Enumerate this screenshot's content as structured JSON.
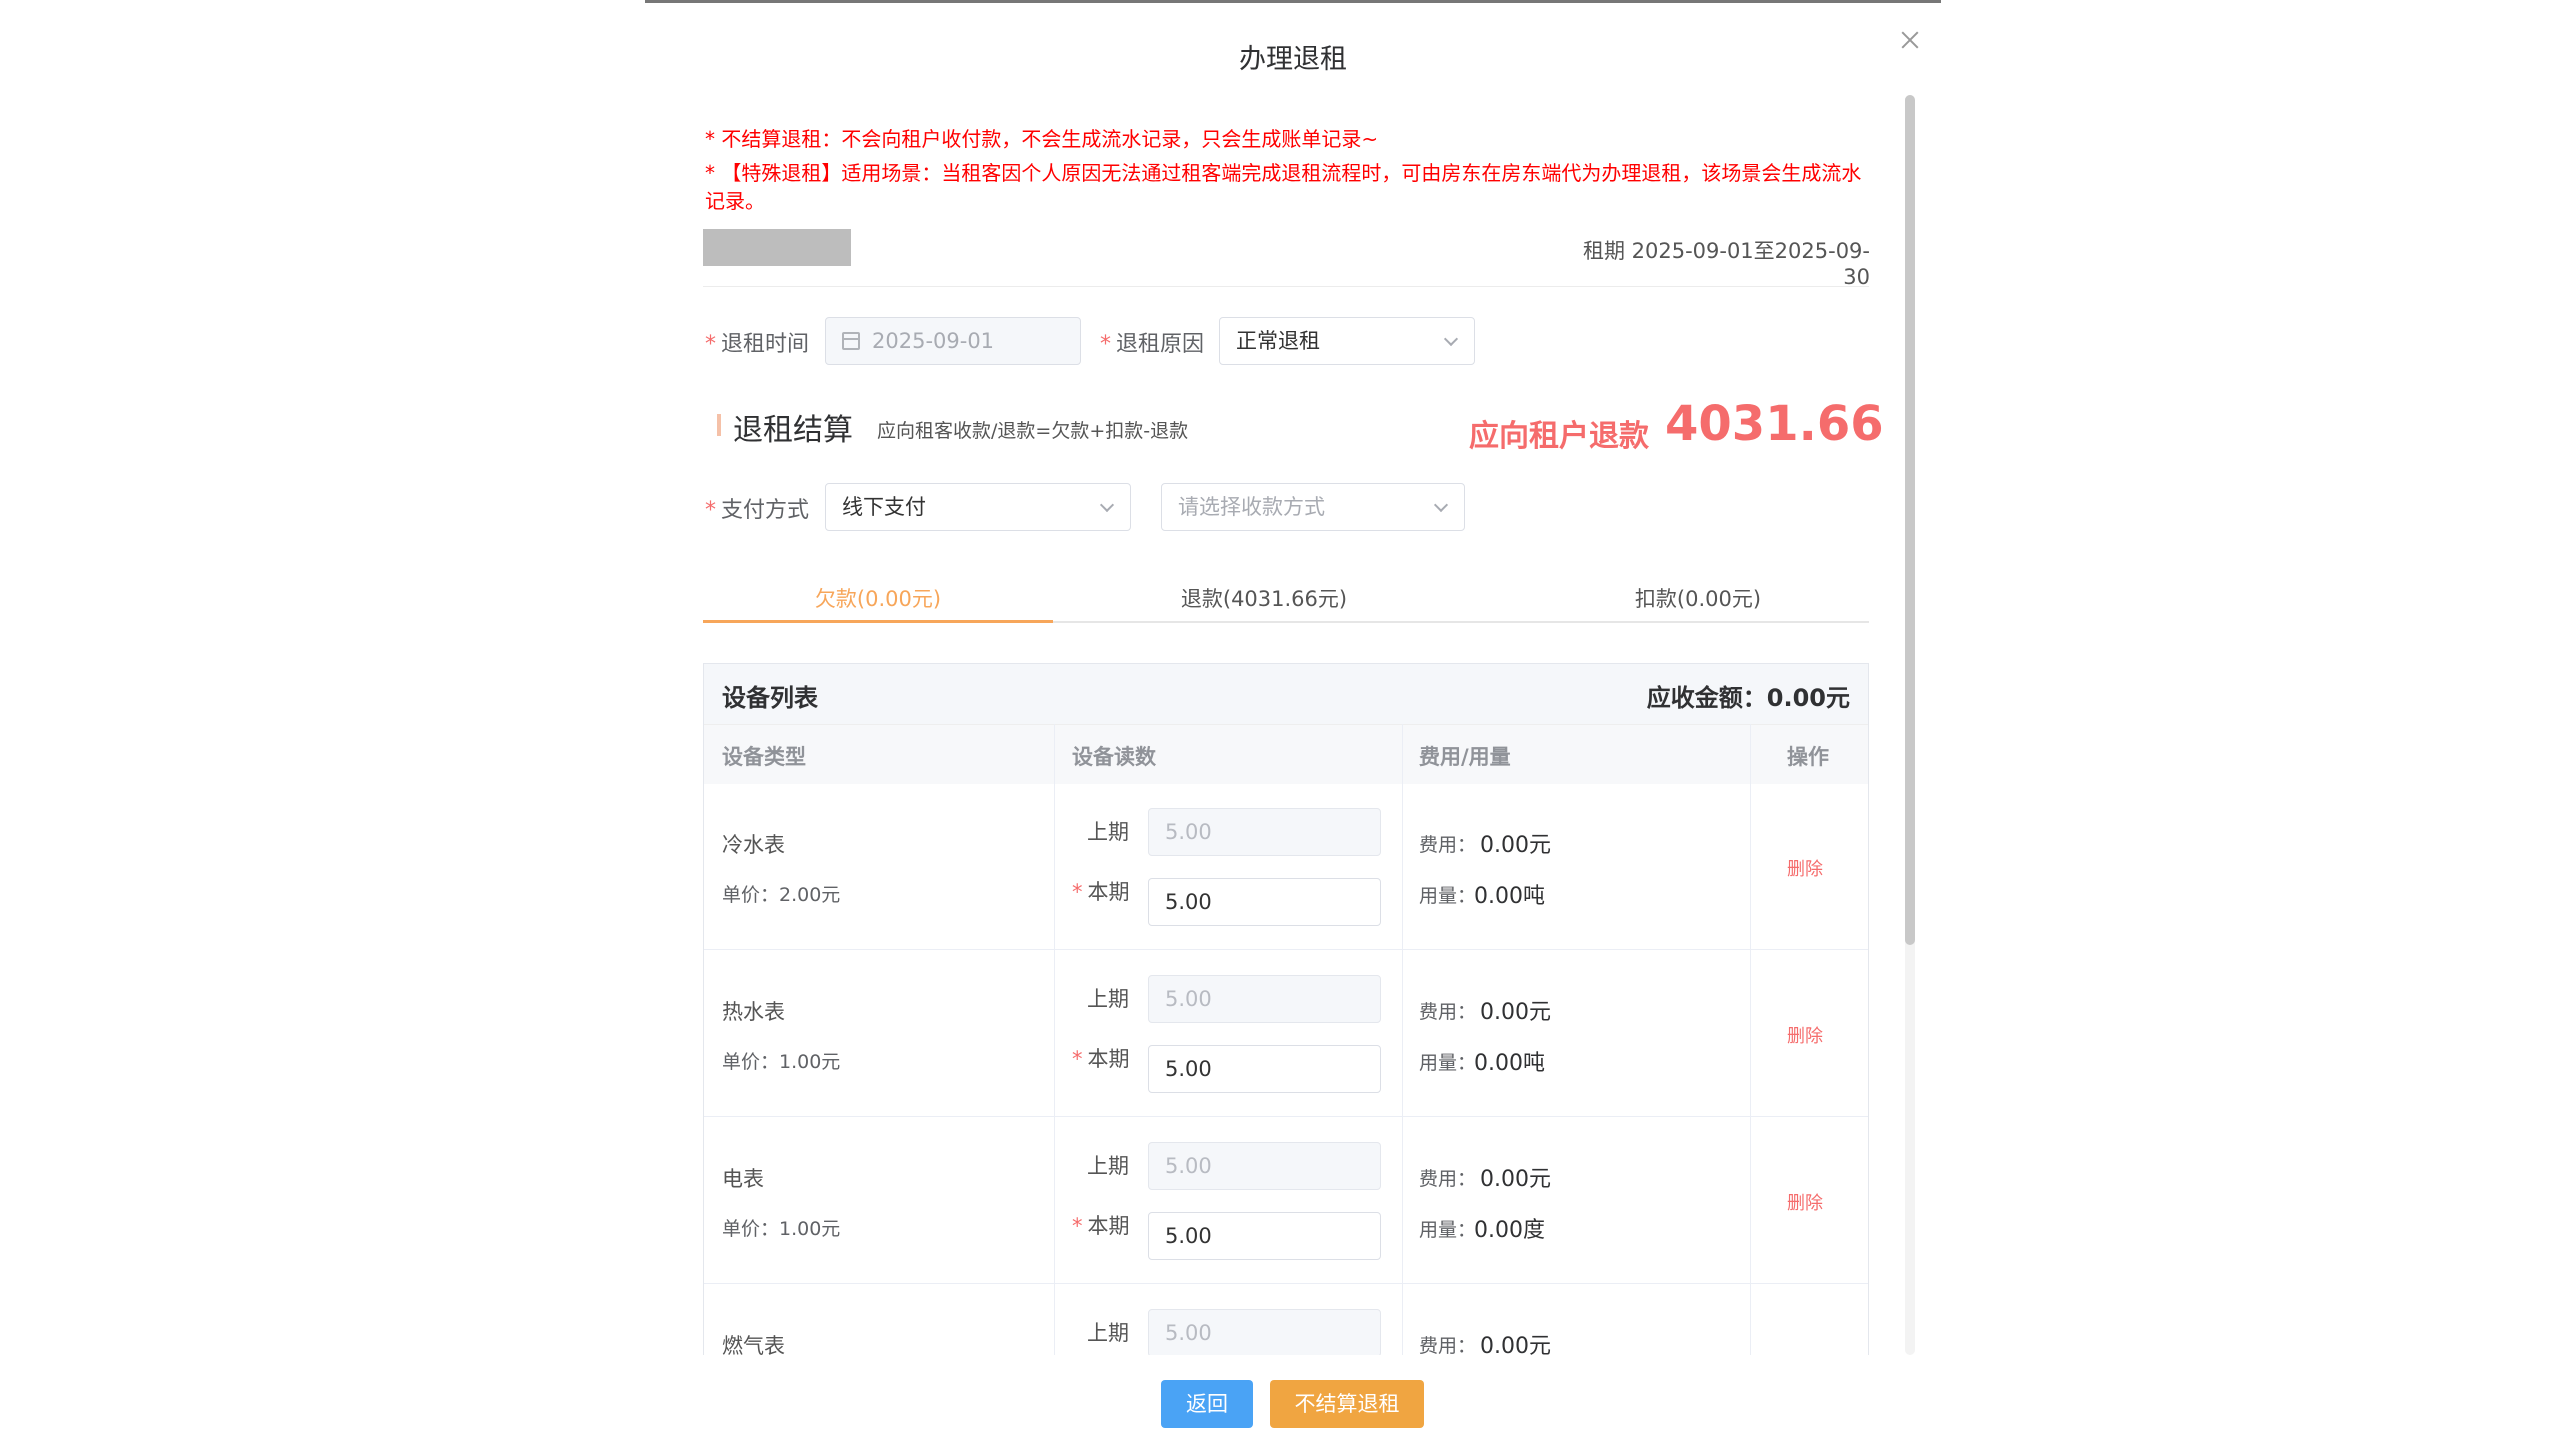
{
  "dialog": {
    "title": "办理退租"
  },
  "notices": [
    "* 不结算退租：不会向租户收付款，不会生成流水记录，只会生成账单记录~",
    "* 【特殊退租】适用场景：当租客因个人原因无法通过租客端完成退租流程时，可由房东在房东端代为办理退租，该场景会生成流水记录。"
  ],
  "lease": {
    "period": "租期 2025-09-01至2025-09-30"
  },
  "form": {
    "checkout_time": {
      "label": "退租时间",
      "value": "2025-09-01"
    },
    "reason": {
      "label": "退租原因",
      "value": "正常退租"
    },
    "payment": {
      "label": "支付方式",
      "value": "线下支付",
      "collect_placeholder": "请选择收款方式"
    }
  },
  "settlement": {
    "title": "退租结算",
    "formula": "应向租客收款/退款=欠款+扣款-退款",
    "refund_label": "应向租户退款",
    "refund_amount": "4031.66"
  },
  "tabs": [
    {
      "label": "欠款(0.00元)",
      "active": true
    },
    {
      "label": "退款(4031.66元)",
      "active": false
    },
    {
      "label": "扣款(0.00元)",
      "active": false
    }
  ],
  "device_list": {
    "title": "设备列表",
    "receivable": "应收金额：0.00元",
    "headers": [
      "设备类型",
      "设备读数",
      "费用/用量",
      "操作"
    ],
    "rows": [
      {
        "name": "冷水表",
        "price": "单价：2.00元",
        "prev_label": "上期",
        "prev": "5.00",
        "cur_label": "本期",
        "cur": "5.00",
        "fee_label": "费用：",
        "fee": "0.00元",
        "usage_label": "用量：",
        "usage": "0.00吨",
        "action": "删除"
      },
      {
        "name": "热水表",
        "price": "单价：1.00元",
        "prev_label": "上期",
        "prev": "5.00",
        "cur_label": "本期",
        "cur": "5.00",
        "fee_label": "费用：",
        "fee": "0.00元",
        "usage_label": "用量：",
        "usage": "0.00吨",
        "action": "删除"
      },
      {
        "name": "电表",
        "price": "单价：1.00元",
        "prev_label": "上期",
        "prev": "5.00",
        "cur_label": "本期",
        "cur": "5.00",
        "fee_label": "费用：",
        "fee": "0.00元",
        "usage_label": "用量：",
        "usage": "0.00度",
        "action": "删除"
      },
      {
        "name": "燃气表",
        "prev_label": "上期",
        "prev": "5.00",
        "fee_label": "费用：",
        "fee": "0.00元"
      }
    ]
  },
  "footer": {
    "back": "返回",
    "submit": "不结算退租"
  },
  "colors": {
    "accent": "#f7a65a",
    "danger": "#f56c6c",
    "primary": "#4aa3f5",
    "warning": "#f0a541"
  }
}
